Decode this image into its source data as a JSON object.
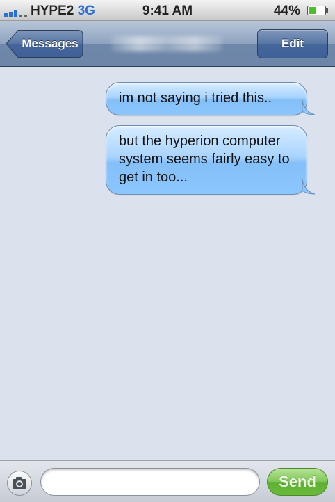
{
  "status_bar": {
    "carrier": "HYPE2",
    "network": "3G",
    "time": "9:41 AM",
    "battery_percent": "44%",
    "battery_level": 0.44,
    "signal_bars": 3
  },
  "nav_bar": {
    "back_label": "Messages",
    "edit_label": "Edit"
  },
  "messages": [
    {
      "text": "im not saying i tried this..",
      "direction": "outgoing"
    },
    {
      "text": "but the hyperion computer system seems fairly easy to get in too...",
      "direction": "outgoing"
    }
  ],
  "input_bar": {
    "text_value": "",
    "send_label": "Send",
    "camera_icon": "camera-icon"
  },
  "colors": {
    "background": "#dbe1ed",
    "bubble": "#a9d4ff",
    "send": "#6abb3c",
    "network": "#2b6fd6"
  }
}
